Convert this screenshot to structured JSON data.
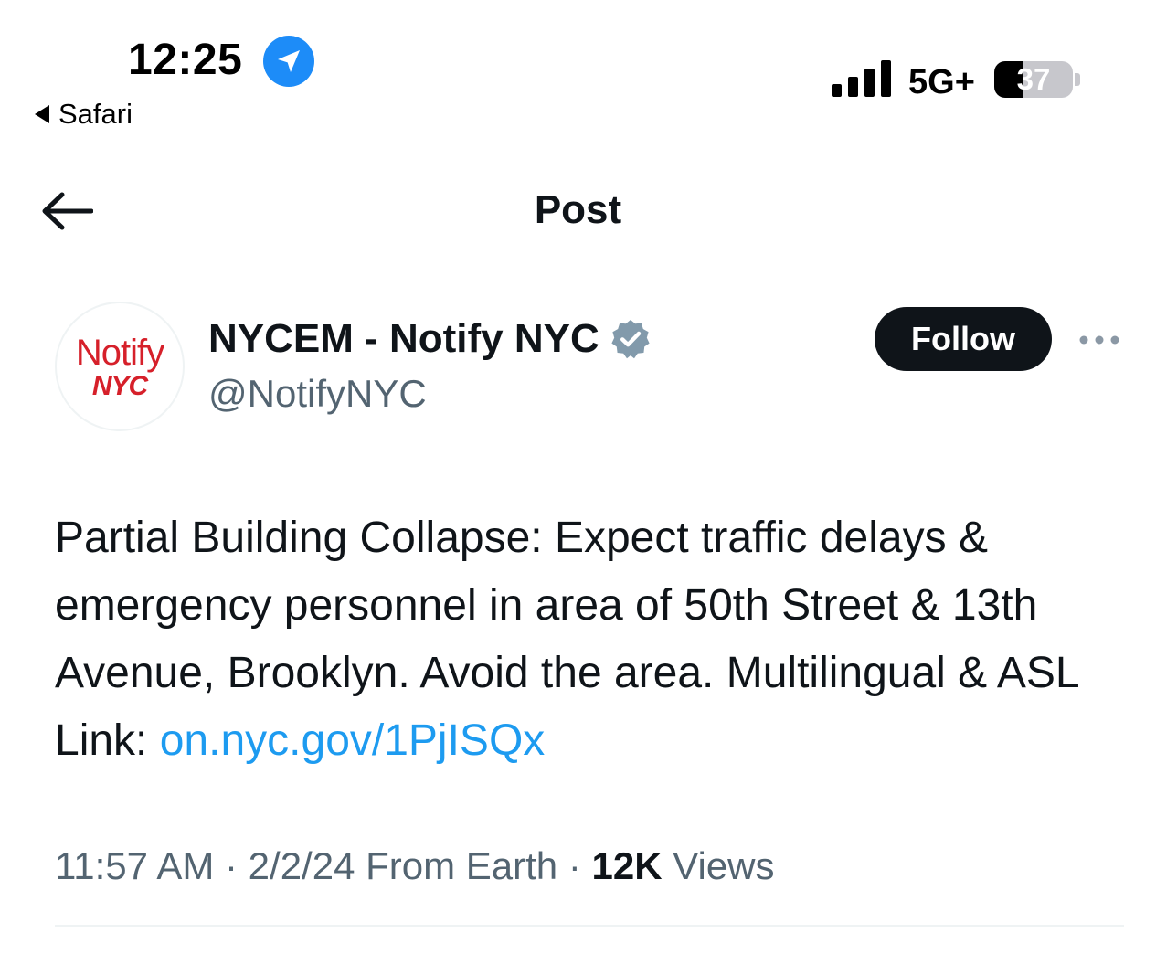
{
  "status_bar": {
    "time": "12:25",
    "back_app": "Safari",
    "network": "5G+",
    "battery": "37",
    "battery_level": 0.37
  },
  "nav": {
    "title": "Post"
  },
  "author": {
    "avatar_line1": "Notify",
    "avatar_line2": "NYC",
    "name": "NYCEM - Notify NYC",
    "handle": "@NotifyNYC",
    "follow_label": "Follow"
  },
  "post": {
    "text": "Partial Building Collapse: Expect traffic delays & emergency personnel in area of 50th Street & 13th Avenue, Brooklyn. Avoid the area. Multilingual & ASL Link: ",
    "link": "on.nyc.gov/1PjISQx",
    "time": "11:57 AM",
    "date": "2/2/24",
    "source": "From Earth",
    "views_count": "12K",
    "views_label": "Views"
  },
  "colors": {
    "accent": "#1d9bf0",
    "text_primary": "#0f1419",
    "text_secondary": "#536471",
    "brand_red": "#d6202a",
    "location_blue": "#1d8cf8"
  }
}
